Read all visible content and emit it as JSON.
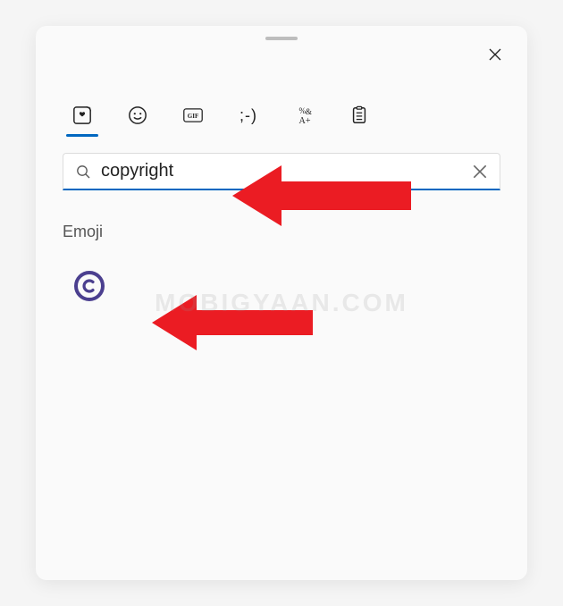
{
  "search": {
    "value": "copyright",
    "placeholder": ""
  },
  "section": {
    "label": "Emoji"
  },
  "result": {
    "name": "copyright",
    "glyph": "©"
  },
  "watermark": "MOBIGYAAN.COM",
  "colors": {
    "accent": "#0067c0",
    "arrow": "#eb1c23",
    "emoji_ring": "#4b3f8f"
  }
}
